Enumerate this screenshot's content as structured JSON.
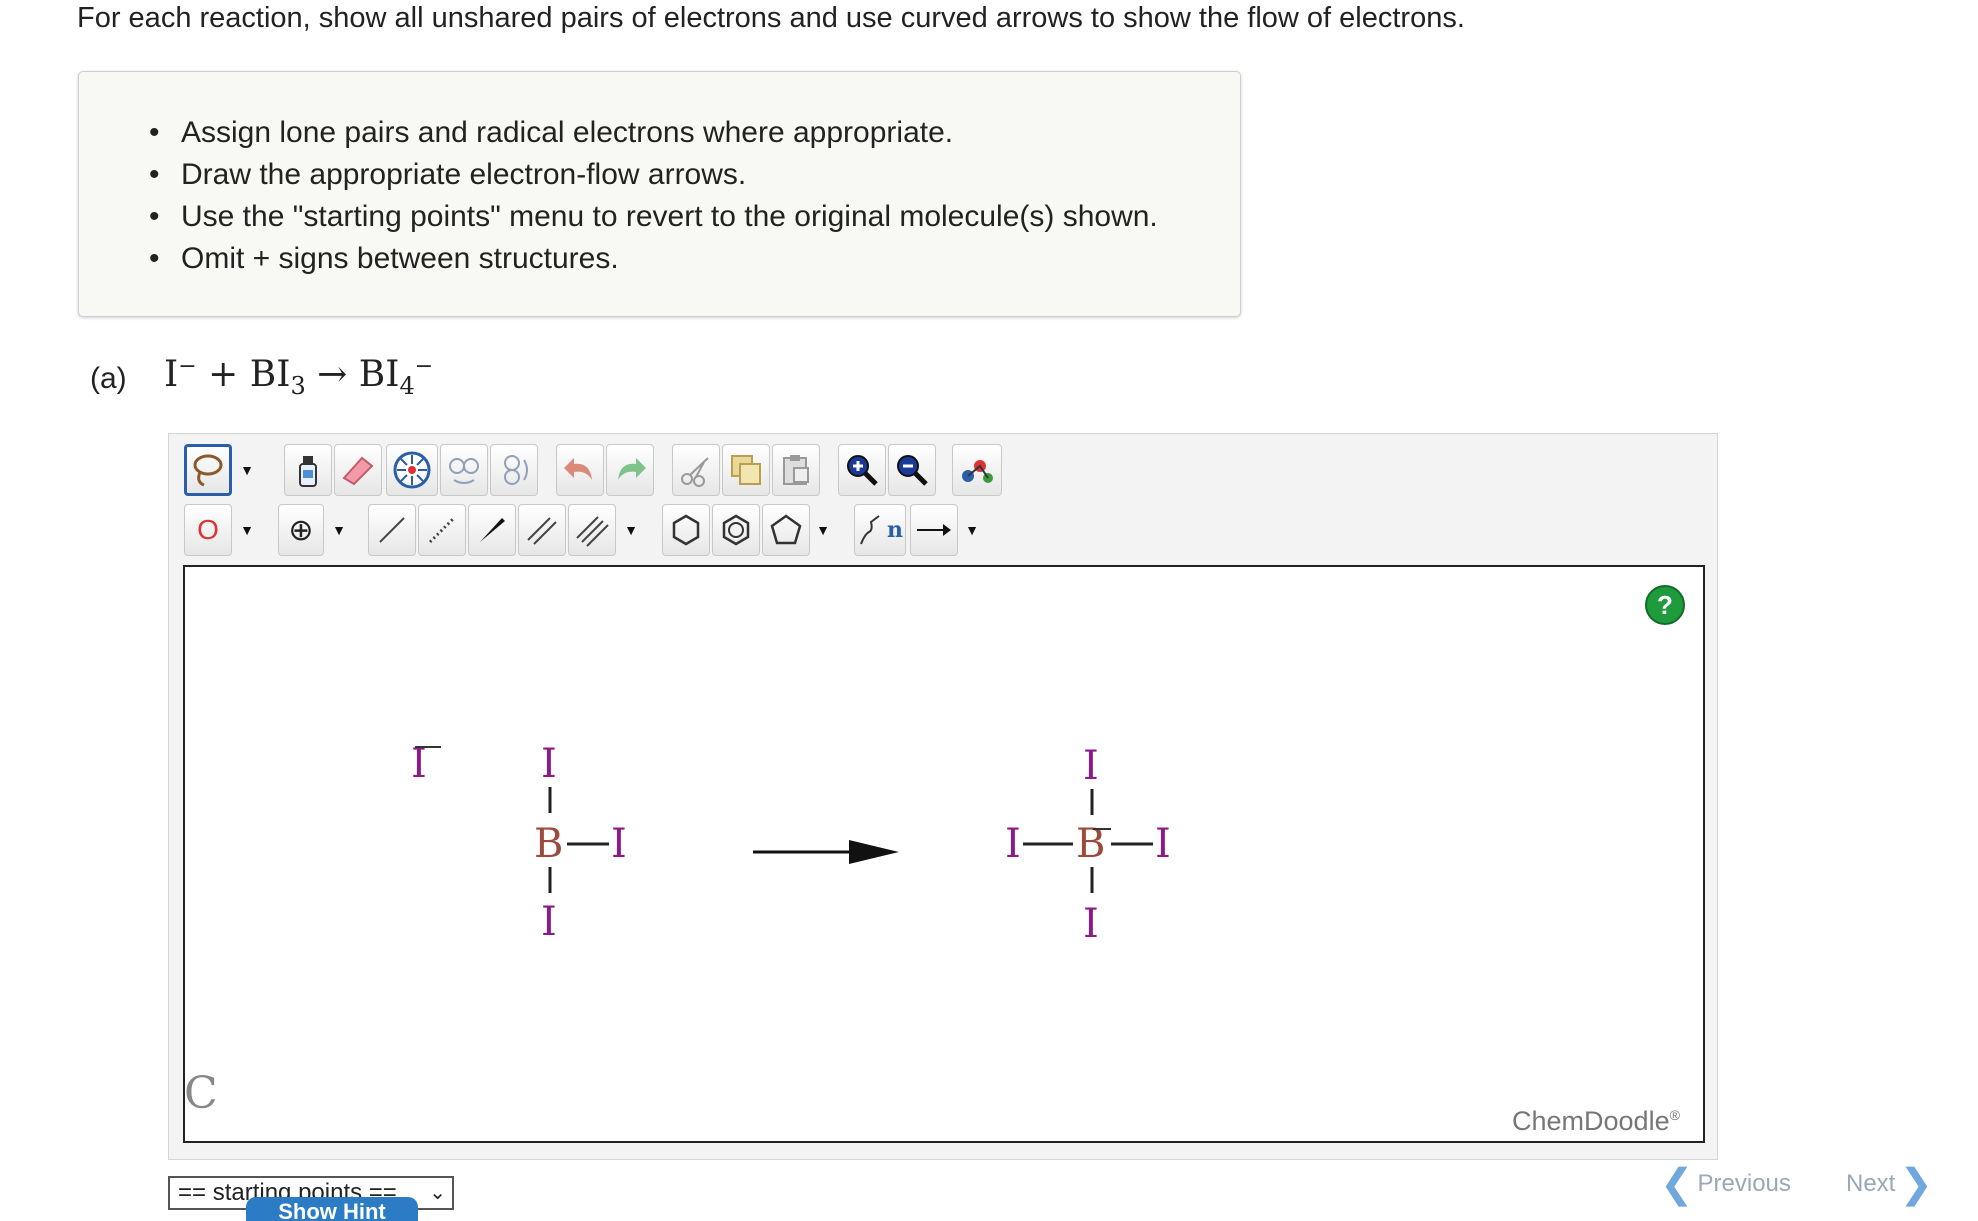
{
  "intro": "For each reaction, show all unshared pairs of electrons and use curved arrows to show the flow of electrons.",
  "instructions": [
    "Assign lone pairs and radical electrons where appropriate.",
    "Draw the appropriate electron-flow arrows.",
    "Use the \"starting points\" menu to revert to the original molecule(s) shown.",
    "Omit + signs between structures."
  ],
  "part": {
    "label": "(a)",
    "eq": {
      "i": "I",
      "minus": "−",
      "plus": "+",
      "bi": "BI",
      "sub3": "3",
      "arrow": "→",
      "bi4": "BI",
      "sub4": "4",
      "minus2": "−"
    }
  },
  "toolbar": {
    "atom_label": "O",
    "charge_label": "⊕",
    "template_label": "n"
  },
  "molecules": {
    "iodide": "I",
    "bi3": {
      "top": "I",
      "center": "B",
      "right": "I",
      "bottom": "I"
    },
    "bi4": {
      "top": "I",
      "left": "I",
      "center": "B",
      "right": "I",
      "bottom": "I"
    }
  },
  "canvas": {
    "help": "?",
    "brand": "ChemDoodle",
    "reg": "®",
    "corner": "C"
  },
  "starting_points": "== starting points ==",
  "hint": "Show Hint",
  "nav": {
    "prev": "Previous",
    "next": "Next"
  },
  "colors": {
    "iodine": "#8b1a8b",
    "boron": "#9c4a3c",
    "help": "#1e9b3c",
    "hint": "#2b7cc4"
  }
}
